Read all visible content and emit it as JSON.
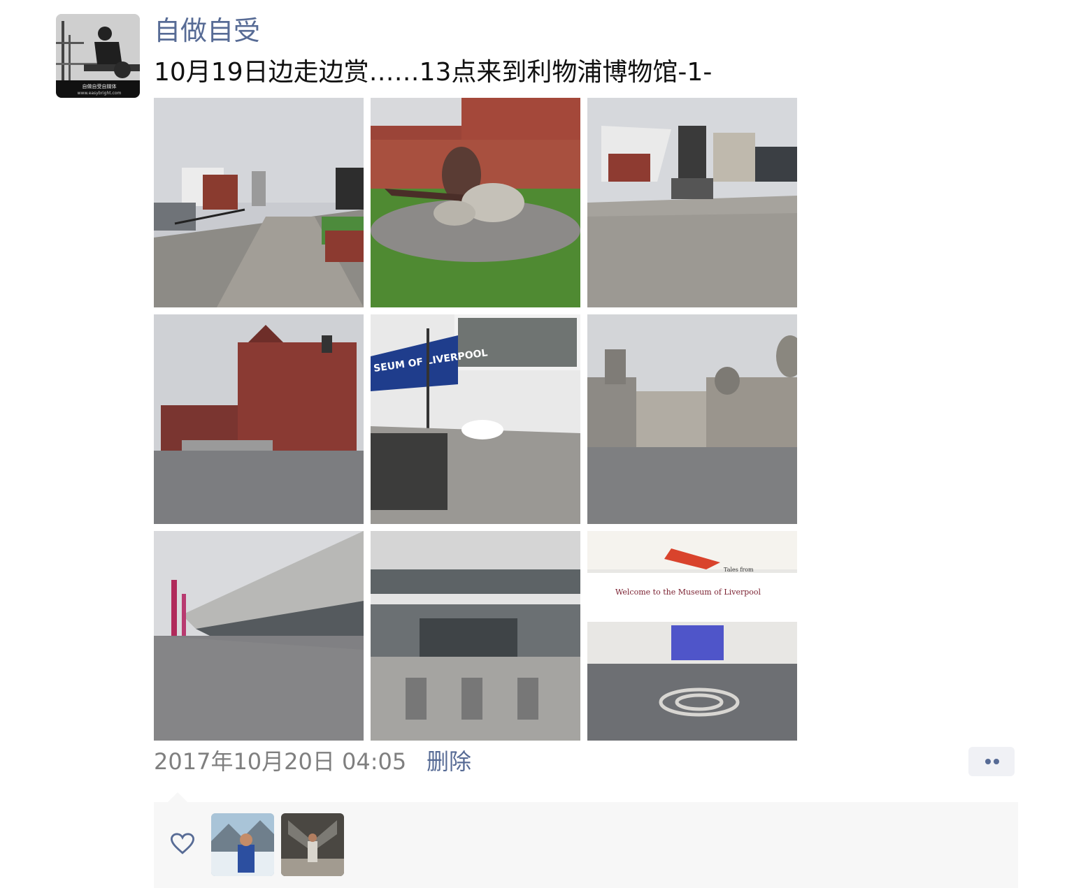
{
  "post": {
    "author": "自做自受",
    "text": "10月19日边走边赏……13点来到利物浦博物馆-1-",
    "timestamp": "2017年10月20日 04:05",
    "delete_label": "删除",
    "avatar_caption": "自做自受自媒体",
    "avatar_url_text": "www.easybright.com"
  },
  "photos": [
    {
      "name": "photo-waterfront-promenade"
    },
    {
      "name": "photo-horn-sculpture"
    },
    {
      "name": "photo-museum-bridge"
    },
    {
      "name": "photo-red-brick-building"
    },
    {
      "name": "photo-museum-entrance",
      "sign_text": "SEUM OF LIVERPOOL"
    },
    {
      "name": "photo-three-graces"
    },
    {
      "name": "photo-museum-exterior"
    },
    {
      "name": "photo-museum-doors"
    },
    {
      "name": "photo-museum-lobby",
      "sign_text": "Welcome to the Museum of Liverpool",
      "sub_sign_text": "Tales from"
    }
  ],
  "likes": {
    "icon": "heart-icon",
    "likers": [
      {
        "name": "liker-avatar-1"
      },
      {
        "name": "liker-avatar-2"
      }
    ]
  },
  "colors": {
    "link": "#576b95",
    "text": "#111111",
    "meta": "#7f7f7f",
    "panel": "#f7f7f7"
  }
}
